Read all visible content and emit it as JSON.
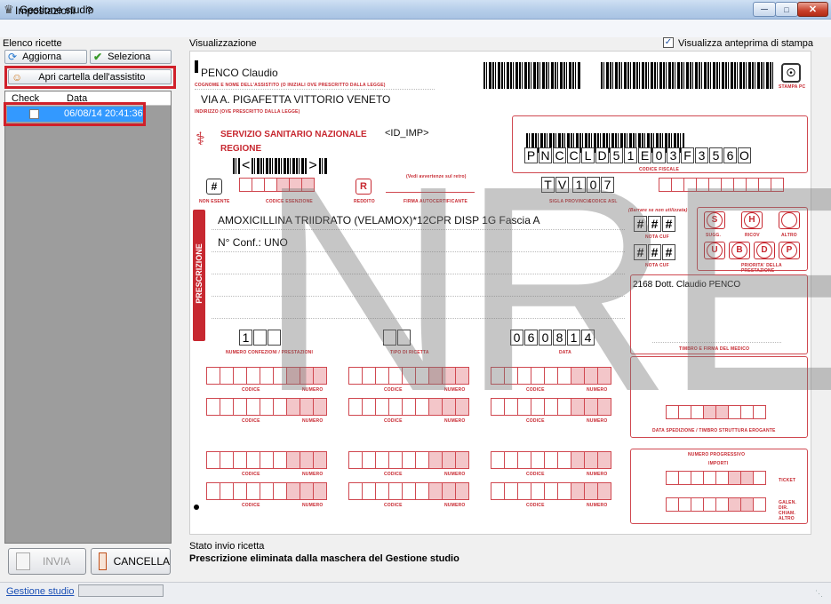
{
  "window": {
    "title": "Gestione studio",
    "app_icon": "app-icon"
  },
  "menu": {
    "impostazioni": "Impostazioni",
    "help": "?"
  },
  "left": {
    "label": "Elenco ricette",
    "aggiorna": "Aggiorna",
    "seleziona": "Seleziona",
    "apri": "Apri cartella dell'assistito",
    "columns": {
      "check": "Check",
      "data": "Data"
    },
    "rows": [
      {
        "checked": false,
        "data": "06/08/14 20:41:36"
      }
    ],
    "invia": "INVIA",
    "cancella": "CANCELLA"
  },
  "right": {
    "label": "Visualizzazione",
    "anteprima_label": "Visualizza anteprima di stampa",
    "anteprima_checked": true,
    "stato_label": "Stato invio ricetta",
    "stato_text": "Prescrizione eliminata dalla maschera del Gestione studio"
  },
  "ricetta": {
    "watermark": "NRE",
    "paziente": "PENCO Claudio",
    "label_paziente": "COGNOME E NOME DELL'ASSISTITO (O INIZIALI OVE PRESCRITTO DALLA LEGGE)",
    "indirizzo": "VIA A. PIGAFETTA  VITTORIO VENETO",
    "label_indirizzo": "INDIRIZZO (OVE PRESCRITTO DALLA LEGGE)",
    "ssn": "SERVIZIO SANITARIO NAZIONALE",
    "regione": "REGIONE",
    "id_imp": "<ID_IMP>",
    "code_marker_left": "<",
    "code_marker_right": ">",
    "codice_fiscale": [
      "P",
      "N",
      "C",
      "C",
      "L",
      "D",
      "5",
      "1",
      "E",
      "0",
      "3",
      "F",
      "3",
      "5",
      "6",
      "O"
    ],
    "label_cf": "CODICE FISCALE",
    "stampa_pc": "STAMPA PC",
    "label_non_esente": "NON ESENTE",
    "label_esenzione": "CODICE ESENZIONE",
    "label_reddito": "REDDITO",
    "label_firma_auto": "FIRMA AUTOCERTIFICANTE",
    "label_avvertenze": "(Vedi avvertenze sul retro)",
    "provincia": [
      "T",
      "V"
    ],
    "asl": [
      "1",
      "0",
      "7"
    ],
    "label_prov": "SIGLA PROVINCIA",
    "label_asl": "CODICE ASL",
    "prescrizione": "AMOXICILLINA TRIIDRATO (VELAMOX)*12CPR DISP 1G Fascia A",
    "n_conf": "N° Conf.: UNO",
    "label_prescrizione": "PRESCRIZIONE",
    "numero_confezioni": "1",
    "label_num_conf": "NUMERO CONFEZIONI / PRESTAZIONI",
    "label_tipo": "TIPO DI RICETTA",
    "data": [
      "0",
      "6",
      "0",
      "8",
      "1",
      "4"
    ],
    "label_data": "DATA",
    "barrare": "(Barrare se non utilizzata)",
    "nota_cuf": "NOTA CUF",
    "hash": "#",
    "letters_top": [
      "S",
      "H",
      ""
    ],
    "labels_top": [
      "SUGG.",
      "RICOV",
      "ALTRO"
    ],
    "letters_prio": [
      "U",
      "B",
      "D",
      "P"
    ],
    "label_prio": "PRIORITA' DELLA PRESTAZIONE",
    "medico": "2168 Dott. Claudio PENCO",
    "label_firma_medico": "TIMBRO E FIRMA DEL MEDICO",
    "label_codice": "CODICE",
    "label_numero": "NUMERO",
    "label_data_sped": "DATA SPEDIZIONE / TIMBRO STRUTTURA EROGANTE",
    "label_num_prog": "NUMERO PROGRESSIVO",
    "label_importi": "IMPORTI",
    "label_ticket": "TICKET",
    "label_galen": "GALEN. DIR. CHIAM. ALTRO"
  },
  "status": {
    "link": "Gestione studio"
  }
}
